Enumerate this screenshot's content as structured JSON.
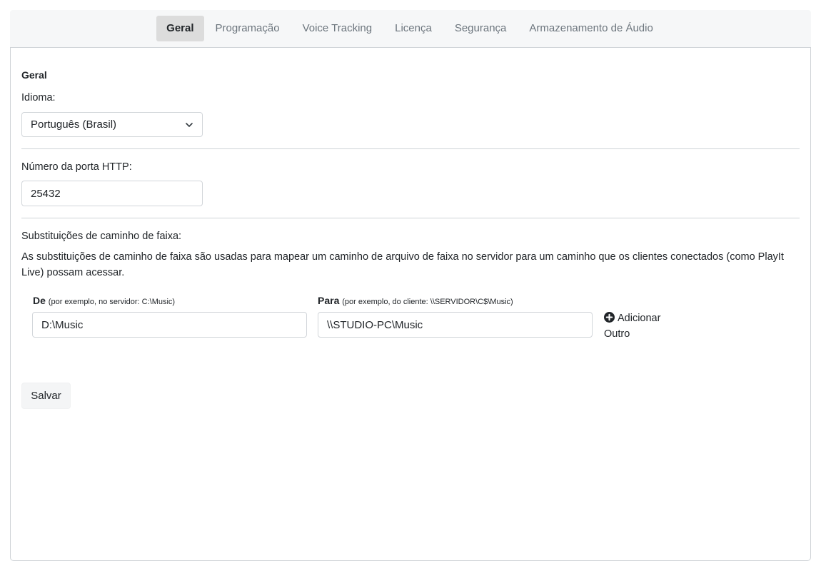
{
  "tabs": [
    {
      "label": "Geral",
      "active": true
    },
    {
      "label": "Programação",
      "active": false
    },
    {
      "label": "Voice Tracking",
      "active": false
    },
    {
      "label": "Licença",
      "active": false
    },
    {
      "label": "Segurança",
      "active": false
    },
    {
      "label": "Armazenamento de Áudio",
      "active": false
    }
  ],
  "general": {
    "section_title": "Geral",
    "language_label": "Idioma:",
    "language_value": "Português (Brasil)",
    "port_label": "Número da porta HTTP:",
    "port_value": "25432"
  },
  "path_substitutions": {
    "title": "Substituições de caminho de faixa:",
    "description": "As substituições de caminho de faixa são usadas para mapear um caminho de arquivo de faixa no servidor para um caminho que os clientes conectados (como PlayIt Live) possam acessar.",
    "from_label": "De",
    "from_hint": "(por exemplo, no servidor: C:\\Music)",
    "from_value": "D:\\Music",
    "to_label": "Para",
    "to_hint": "(por exemplo, do cliente: \\\\SERVIDOR\\C$\\Music)",
    "to_value": "\\\\STUDIO-PC\\Music",
    "add_label": "Adicionar Outro",
    "add_icon": "plus-circle-icon"
  },
  "save_label": "Salvar",
  "colors": {
    "tabbar_bg": "#f6f7f8",
    "active_tab_bg": "#dcdcdc",
    "border": "#cfd3d7",
    "text": "#212529",
    "muted_text": "#6c757d"
  }
}
